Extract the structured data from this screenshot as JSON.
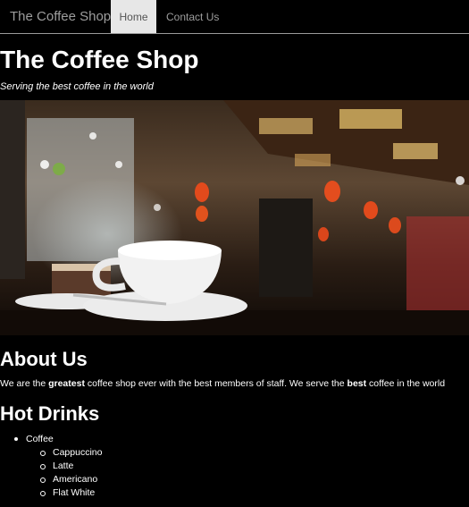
{
  "navbar": {
    "brand": "The Coffee Shop",
    "home": "Home",
    "contact": "Contact Us"
  },
  "header": {
    "title": "The Coffee Shop",
    "tagline": "Serving the best coffee in the world"
  },
  "about": {
    "title": "About Us",
    "text_1": "We are the ",
    "bold_1": "greatest",
    "text_2": " coffee shop ever with the best members of staff. We serve the ",
    "bold_2": "best",
    "text_3": " coffee in the world"
  },
  "drinks": {
    "title": "Hot Drinks",
    "category": "Coffee",
    "items": [
      "Cappuccino",
      "Latte",
      "Americano",
      "Flat White"
    ]
  }
}
